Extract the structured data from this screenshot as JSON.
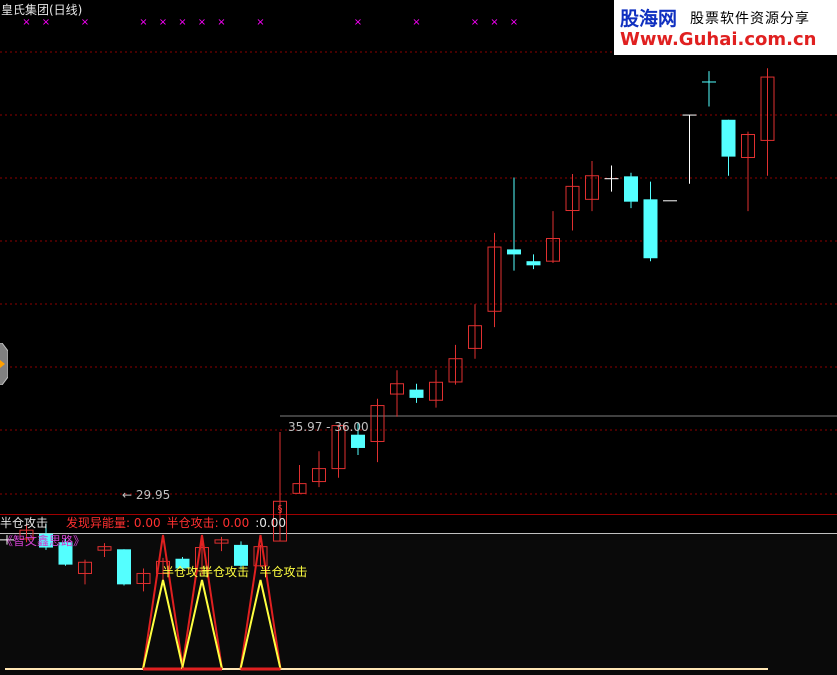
{
  "title": "皇氏集团(日线)",
  "price_high_label": "35.97 - 36.00",
  "price_low_label": "← 29.95",
  "indicator": {
    "name": "半仓攻击",
    "fields": [
      {
        "label": "发现异能量:",
        "value": "0.00"
      },
      {
        "label": "半仓攻击:",
        "value": "0.00"
      },
      {
        "label": ":",
        "value": "0.00"
      }
    ],
    "formula_name": "《智文鑫思路》",
    "signal_label": "半仓攻击"
  },
  "watermark": {
    "logo": "股海网",
    "slogan": "股票软件资源分享",
    "url": "Www.Guhai.com.cn"
  },
  "colors": {
    "up": "#e03030",
    "down": "#54ffff",
    "grid": "#8b0000",
    "marker": "#ff00ff",
    "signal_red": "#e02020",
    "signal_yellow": "#ffff40",
    "baseline": "#ffe6b4"
  },
  "chart_data": {
    "type": "candlestick",
    "candles": [
      {
        "o": 32.34,
        "c": 32.34,
        "h": 32.5,
        "l": 32.18,
        "dir": "flat"
      },
      {
        "o": 32.37,
        "c": 32.67,
        "h": 32.89,
        "l": 32.26,
        "dir": "up"
      },
      {
        "o": 32.55,
        "c": 32.08,
        "h": 32.89,
        "l": 32.0,
        "dir": "down"
      },
      {
        "o": 32.26,
        "c": 31.5,
        "h": 32.37,
        "l": 31.46,
        "dir": "down"
      },
      {
        "o": 31.2,
        "c": 31.58,
        "h": 31.67,
        "l": 30.83,
        "dir": "up"
      },
      {
        "o": 31.99,
        "c": 32.11,
        "h": 32.23,
        "l": 31.76,
        "dir": "up"
      },
      {
        "o": 32.02,
        "c": 30.83,
        "h": 32.02,
        "l": 30.79,
        "dir": "down"
      },
      {
        "o": 30.86,
        "c": 31.2,
        "h": 31.37,
        "l": 30.59,
        "dir": "up"
      },
      {
        "o": 31.2,
        "c": 31.61,
        "h": 31.73,
        "l": 30.9,
        "dir": "up"
      },
      {
        "o": 31.7,
        "c": 31.37,
        "h": 31.76,
        "l": 31.32,
        "dir": "down"
      },
      {
        "o": 31.29,
        "c": 32.08,
        "h": 32.26,
        "l": 31.14,
        "dir": "up"
      },
      {
        "o": 32.23,
        "c": 32.34,
        "h": 32.44,
        "l": 31.96,
        "dir": "up"
      },
      {
        "o": 32.17,
        "c": 31.46,
        "h": 32.29,
        "l": 31.34,
        "dir": "down"
      },
      {
        "o": 31.46,
        "c": 32.11,
        "h": 32.17,
        "l": 31.43,
        "dir": "up"
      },
      {
        "o": 32.3,
        "c": 33.65,
        "h": 36.0,
        "l": 32.3,
        "dir": "up"
      },
      {
        "o": 33.92,
        "c": 34.25,
        "h": 34.88,
        "l": 33.92,
        "dir": "up"
      },
      {
        "o": 34.32,
        "c": 34.76,
        "h": 35.35,
        "l": 34.13,
        "dir": "up"
      },
      {
        "o": 34.76,
        "c": 36.22,
        "h": 36.25,
        "l": 34.45,
        "dir": "up"
      },
      {
        "o": 35.91,
        "c": 35.46,
        "h": 36.3,
        "l": 35.22,
        "dir": "down"
      },
      {
        "o": 35.68,
        "c": 36.9,
        "h": 37.13,
        "l": 34.98,
        "dir": "up"
      },
      {
        "o": 37.29,
        "c": 37.64,
        "h": 38.1,
        "l": 36.52,
        "dir": "up"
      },
      {
        "o": 37.44,
        "c": 37.16,
        "h": 37.64,
        "l": 36.99,
        "dir": "down"
      },
      {
        "o": 37.08,
        "c": 37.69,
        "h": 38.11,
        "l": 36.83,
        "dir": "up"
      },
      {
        "o": 37.7,
        "c": 38.49,
        "h": 38.96,
        "l": 37.61,
        "dir": "up"
      },
      {
        "o": 38.84,
        "c": 39.61,
        "h": 40.34,
        "l": 38.49,
        "dir": "up"
      },
      {
        "o": 40.1,
        "c": 42.28,
        "h": 42.76,
        "l": 39.56,
        "dir": "up"
      },
      {
        "o": 42.2,
        "c": 42.03,
        "h": 44.64,
        "l": 41.48,
        "dir": "down"
      },
      {
        "o": 41.8,
        "c": 41.66,
        "h": 42.03,
        "l": 41.53,
        "dir": "down"
      },
      {
        "o": 41.8,
        "c": 42.57,
        "h": 43.5,
        "l": 41.74,
        "dir": "up"
      },
      {
        "o": 43.52,
        "c": 44.34,
        "h": 44.76,
        "l": 42.84,
        "dir": "up"
      },
      {
        "o": 43.9,
        "c": 44.7,
        "h": 45.2,
        "l": 43.5,
        "dir": "up"
      },
      {
        "o": 44.5,
        "c": 44.6,
        "h": 45.05,
        "l": 44.16,
        "dir": "flat"
      },
      {
        "o": 44.68,
        "c": 43.82,
        "h": 44.8,
        "l": 43.6,
        "dir": "down"
      },
      {
        "o": 43.9,
        "c": 41.9,
        "h": 44.5,
        "l": 41.8,
        "dir": "down"
      },
      {
        "o": 43.85,
        "c": 43.85,
        "h": 43.85,
        "l": 43.85,
        "dir": "flat"
      },
      {
        "o": 46.76,
        "c": 46.76,
        "h": 46.76,
        "l": 44.43,
        "dir": "flat"
      },
      {
        "o": 47.9,
        "c": 47.9,
        "h": 48.25,
        "l": 47.05,
        "dir": "down"
      },
      {
        "o": 46.6,
        "c": 45.35,
        "h": 46.6,
        "l": 44.7,
        "dir": "down"
      },
      {
        "o": 45.32,
        "c": 46.1,
        "h": 46.2,
        "l": 43.5,
        "dir": "up"
      },
      {
        "o": 45.9,
        "c": 48.05,
        "h": 48.35,
        "l": 44.7,
        "dir": "up"
      }
    ],
    "markers": [
      1,
      2,
      4,
      7,
      8,
      9,
      10,
      11,
      13,
      18,
      21,
      24,
      25,
      26
    ],
    "signals": [
      8,
      10,
      13
    ],
    "high_marker": 14
  }
}
